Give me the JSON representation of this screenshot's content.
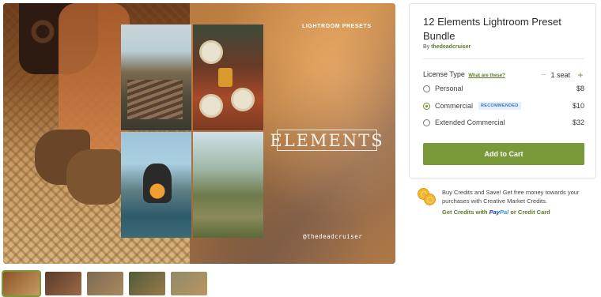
{
  "gallery": {
    "hero_overlay_title": "ELEMENTS",
    "hero_overlay_top": "LIGHTROOM PRESETS",
    "hero_overlay_handle": "@thedeadcruiser",
    "thumbnails": [
      {
        "name": "thumbnail-1",
        "active": true,
        "colors": [
          "#8a5428",
          "#c89a62"
        ]
      },
      {
        "name": "thumbnail-2",
        "active": false,
        "colors": [
          "#5a3b2a",
          "#9b6a45"
        ]
      },
      {
        "name": "thumbnail-3",
        "active": false,
        "colors": [
          "#7b6a52",
          "#a98a5f"
        ]
      },
      {
        "name": "thumbnail-4",
        "active": false,
        "colors": [
          "#4f5a3a",
          "#9a7a4a"
        ]
      },
      {
        "name": "thumbnail-5",
        "active": false,
        "colors": [
          "#8f8a6a",
          "#b89660"
        ]
      }
    ]
  },
  "product": {
    "title": "12 Elements Lightroom Preset Bundle",
    "by_label": "By",
    "author": "thedeadcruiser"
  },
  "license": {
    "label": "License Type",
    "help_link": "What are these?",
    "minus": "−",
    "seats": "1 seat",
    "plus": "+",
    "options": [
      {
        "label": "Personal",
        "price": "$8",
        "selected": false,
        "badge": ""
      },
      {
        "label": "Commercial",
        "price": "$10",
        "selected": true,
        "badge": "RECOMMENDED"
      },
      {
        "label": "Extended Commercial",
        "price": "$32",
        "selected": false,
        "badge": ""
      }
    ]
  },
  "cart": {
    "button_label": "Add to Cart"
  },
  "credits": {
    "icon": "coins-icon",
    "text": "Buy Credits and Save! Get free money towards your purchases with Creative Market Credits.",
    "link_prefix": "Get Credits with",
    "paypal_pay": "Pay",
    "paypal_pal": "Pal",
    "link_suffix": "or Credit Card"
  },
  "colors": {
    "accent": "#7a9a3a",
    "link": "#5d7a2a",
    "badge_bg": "#e3f0fb",
    "badge_text": "#3a78b5"
  }
}
